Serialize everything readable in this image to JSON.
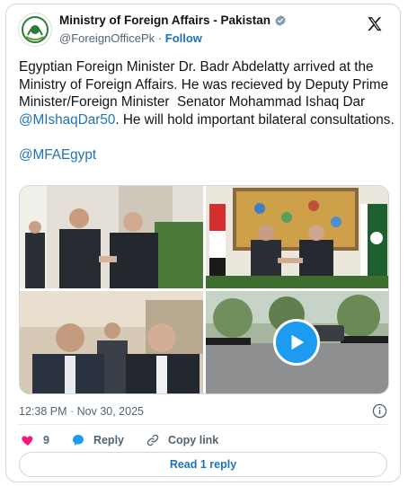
{
  "author": {
    "display_name": "Ministry of Foreign Affairs - Pakistan",
    "handle": "@ForeignOfficePk",
    "separator": "·",
    "follow_label": "Follow"
  },
  "tweet": {
    "text_part1": "Egyptian Foreign Minister Dr. Badr Abdelatty arrived at the Ministry of Foreign Affairs. He was recieved by Deputy Prime Minister/Foreign Minister  Senator Mohammad Ishaq Dar ",
    "mention1": "@MIshaqDar50",
    "text_part2": ". He will hold important bilateral consultations.",
    "mention2": "@MFAEgypt"
  },
  "media": {
    "items": [
      {
        "kind": "photo",
        "description_icon": "photo-handshake-hallway"
      },
      {
        "kind": "photo",
        "description_icon": "photo-handshake-flags"
      },
      {
        "kind": "photo",
        "description_icon": "photo-walking-group"
      },
      {
        "kind": "video",
        "description_icon": "video-motorcade"
      }
    ]
  },
  "timestamp": "12:38 PM · Nov 30, 2025",
  "actions": {
    "like_count": "9",
    "reply_label": "Reply",
    "copy_link_label": "Copy link"
  },
  "read_replies_label": "Read 1 reply",
  "colors": {
    "accent": "#1d9bf0",
    "link": "#1d73b8",
    "like": "#f91880",
    "verified": "#829aab"
  }
}
